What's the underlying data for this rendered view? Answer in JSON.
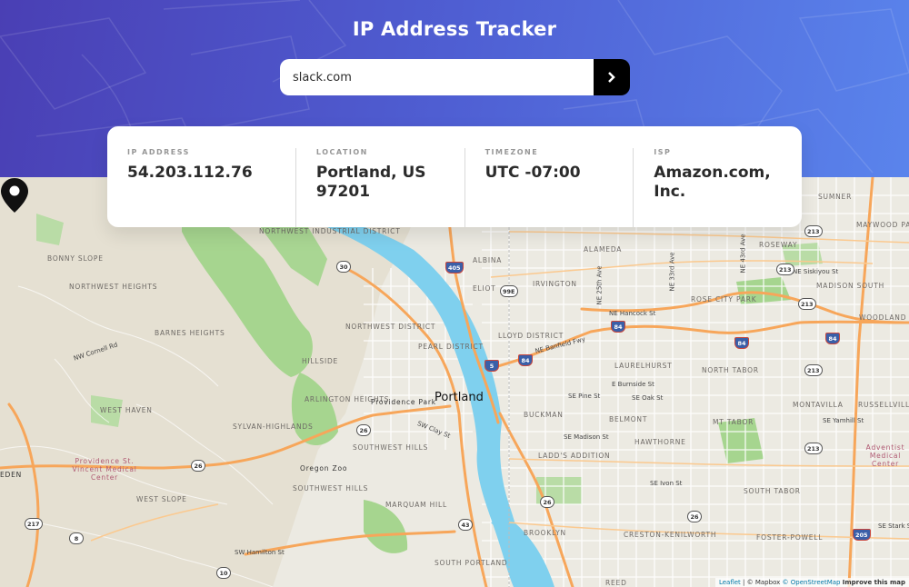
{
  "header": {
    "title": "IP Address Tracker",
    "search_value": "slack.com",
    "search_button_icon": "chevron-right-icon"
  },
  "info": [
    {
      "label": "IP ADDRESS",
      "value": "54.203.112.76"
    },
    {
      "label": "LOCATION",
      "value": "Portland, US 97201"
    },
    {
      "label": "TIMEZONE",
      "value": "UTC -07:00"
    },
    {
      "label": "ISP",
      "value": "Amazon.com, Inc."
    }
  ],
  "map": {
    "city": "Portland",
    "marker_icon": "location-pin-icon",
    "neighborhoods": {
      "nw_industrial": "NORTHWEST INDUSTRIAL DISTRICT",
      "bonny_slope": "BONNY SLOPE",
      "northwest_heights": "NORTHWEST HEIGHTS",
      "barnes_heights": "BARNES HEIGHTS",
      "northwest_district": "NORTHWEST DISTRICT",
      "pearl_district": "PEARL DISTRICT",
      "lloyd_district": "LLOYD DISTRICT",
      "hillside": "HILLSIDE",
      "arlington_heights": "ARLINGTON HEIGHTS",
      "west_haven": "WEST HAVEN",
      "sylvan_highlands": "SYLVAN-HIGHLANDS",
      "southwest_hills": "SOUTHWEST HILLS",
      "southwest_hills_2": "SOUTHWEST HILLS",
      "west_slope": "WEST SLOPE",
      "marquam_hill": "MARQUAM HILL",
      "south_portland": "SOUTH PORTLAND",
      "albina": "ALBINA",
      "eliot": "ELIOT",
      "irvington": "IRVINGTON",
      "alameda": "ALAMEDA",
      "rose_city_park": "ROSE CITY PARK",
      "roseway": "ROSEWAY",
      "madison_south": "MADISON SOUTH",
      "sumner": "SUMNER",
      "maywood_park": "MAYWOOD PARK",
      "woodland_park": "WOODLAND PARK",
      "laurelhurst": "LAURELHURST",
      "north_tabor": "NORTH TABOR",
      "buckman": "BUCKMAN",
      "belmont": "BELMONT",
      "mt_tabor": "MT TABOR",
      "montavilla": "MONTAVILLA",
      "russellville": "RUSSELLVILLE",
      "hawthorne": "HAWTHORNE",
      "ladds_addition": "LADD'S ADDITION",
      "south_tabor": "SOUTH TABOR",
      "brooklyn": "BROOKLYN",
      "creston_kenilworth": "CRESTON-KENILWORTH",
      "foster_powell": "FOSTER-POWELL",
      "reed": "REED",
      "eden": "EDEN",
      "providence_park": "Providence Park",
      "oregon_zoo": "Oregon Zoo",
      "providence_medical": "Providence St. Vincent Medical Center",
      "adventist_medical": "Adventist Medical Center"
    },
    "roads": {
      "nw_cornell": "NW Cornell Rd",
      "sw_clay": "SW Clay St",
      "sw_hamilton": "SW Hamilton St",
      "ne_banfield": "NE Banfield Fwy",
      "ne_hancock": "NE Hancock St",
      "e_burnside": "E Burnside St",
      "se_pine": "SE Pine St",
      "se_oak": "SE Oak St",
      "se_madison": "SE Madison St",
      "se_ivon": "SE Ivon St",
      "se_yamhill": "SE Yamhill St",
      "se_stark": "SE Stark St",
      "ne_siskiyou": "NE Siskiyou St",
      "ne_25th": "NE 25th Ave",
      "ne_33rd": "NE 33rd Ave",
      "ne_43rd": "NE 43rd Ave"
    },
    "shields": [
      "30",
      "405",
      "99E",
      "5",
      "84",
      "84",
      "84",
      "84",
      "26",
      "26",
      "26",
      "26",
      "213",
      "213",
      "213",
      "213",
      "213",
      "217",
      "10",
      "8",
      "43",
      "205"
    ],
    "attribution": {
      "leaflet": "Leaflet",
      "mapbox": "© Mapbox",
      "osm": "© OpenStreetMap",
      "improve": "Improve this map"
    }
  },
  "colors": {
    "header_start": "#4a3fb4",
    "header_end": "#5a84ec",
    "water": "#7fd0ee",
    "park": "#9dd48a",
    "highway": "#f7a65a"
  }
}
